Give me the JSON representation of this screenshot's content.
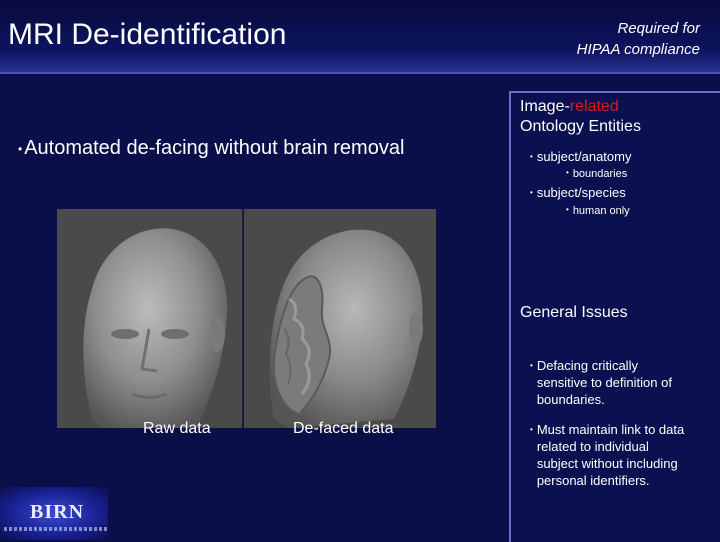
{
  "header": {
    "title": "MRI De-identification",
    "compliance_line1": "Required for",
    "compliance_line2": "HIPAA compliance"
  },
  "main": {
    "bullet": "Automated de-facing without brain removal",
    "captions": {
      "raw": "Raw data",
      "defaced": "De-faced data"
    }
  },
  "panel": {
    "ontology_heading_pre": "Image-",
    "ontology_heading_red": "related",
    "ontology_heading_line2": "Ontology Entities",
    "ontology_items": [
      {
        "label": "subject/anatomy",
        "sub": "boundaries"
      },
      {
        "label": "subject/species",
        "sub": "human only"
      }
    ],
    "issues_heading": "General Issues",
    "issues": [
      {
        "lines": [
          "Defacing critically",
          "sensitive to definition of",
          "boundaries."
        ]
      },
      {
        "lines": [
          "Must maintain link to data",
          "related to individual",
          "subject without including",
          "personal identifiers."
        ]
      }
    ]
  },
  "logo": {
    "text": "BIRN"
  },
  "colors": {
    "background": "#0a0f4a",
    "accent_red": "#e01818",
    "panel_border": "#6a72c8"
  }
}
